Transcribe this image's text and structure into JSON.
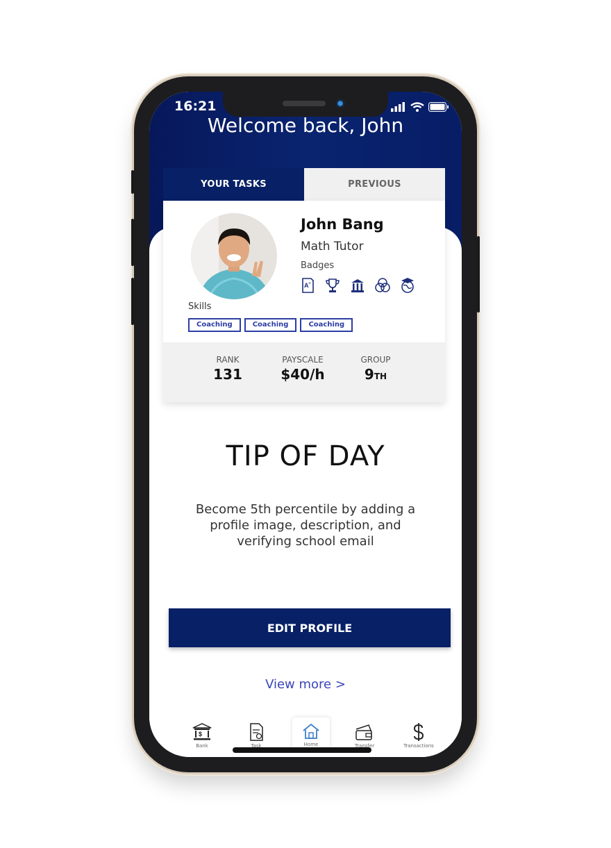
{
  "status_bar": {
    "time": "16:21"
  },
  "header": {
    "welcome": "Welcome back, John"
  },
  "tabs": [
    {
      "label": "YOUR TASKS",
      "active": true
    },
    {
      "label": "PREVIOUS",
      "active": false
    }
  ],
  "profile": {
    "name": "John Bang",
    "role": "Math Tutor",
    "badges_label": "Badges",
    "badges": [
      "grade-a-plus-icon",
      "trophy-icon",
      "building-icon",
      "venn-icon",
      "globe-graduation-icon"
    ],
    "skills_label": "Skills",
    "skills": [
      "Coaching",
      "Coaching",
      "Coaching"
    ]
  },
  "stats": {
    "rank": {
      "label": "RANK",
      "value": "131"
    },
    "payscale": {
      "label": "PAYSCALE",
      "value": "$40/h"
    },
    "group": {
      "label": "GROUP",
      "value": "9",
      "suffix": "TH"
    }
  },
  "tip": {
    "title": "TIP OF DAY",
    "body": "Become 5th percentile by adding a profile image, description, and verifying school email"
  },
  "actions": {
    "edit_profile": "EDIT PROFILE",
    "view_more": "View more >"
  },
  "tabbar": [
    {
      "label": "Bank",
      "icon": "bank-icon"
    },
    {
      "label": "Task",
      "icon": "task-icon"
    },
    {
      "label": "Home",
      "icon": "home-icon",
      "active": true
    },
    {
      "label": "Transfer",
      "icon": "transfer-icon"
    },
    {
      "label": "Transactions",
      "icon": "dollar-icon"
    }
  ],
  "colors": {
    "primary": "#072066",
    "accent": "#2b3da6",
    "link": "#3b45b7"
  }
}
